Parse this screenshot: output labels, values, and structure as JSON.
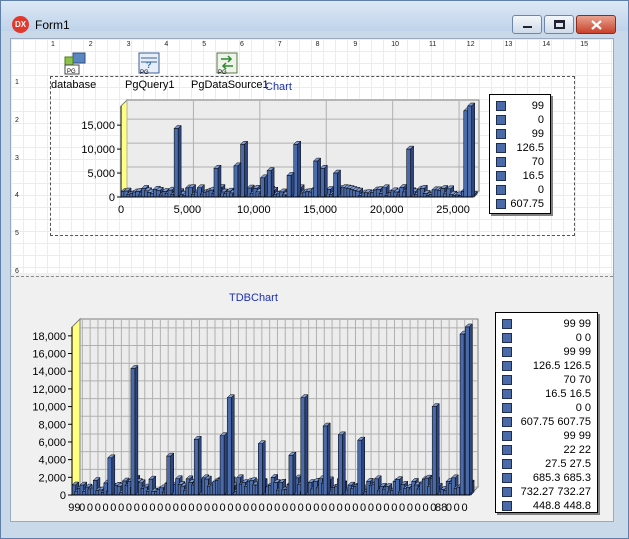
{
  "window": {
    "title": "Form1",
    "app_icon_text": "DX"
  },
  "ruler": {
    "h": [
      "1",
      "2",
      "3",
      "4",
      "5",
      "6",
      "7",
      "8",
      "9",
      "10",
      "11",
      "12",
      "13",
      "14",
      "15"
    ],
    "v": [
      "1",
      "2",
      "3",
      "4",
      "5",
      "6"
    ]
  },
  "components": [
    {
      "label": "database",
      "icon": "database-icon"
    },
    {
      "label": "PgQuery1",
      "icon": "query-icon"
    },
    {
      "label": "PgDataSource1",
      "icon": "datasource-icon"
    }
  ],
  "chart_data": [
    {
      "type": "bar",
      "title": "TDBChart",
      "title_visible": "Chart",
      "xlabel": "",
      "ylabel": "",
      "xlim": [
        0,
        26500
      ],
      "ylim": [
        0,
        19000
      ],
      "x_ticks": [
        "0",
        "5,000",
        "10,000",
        "15,000",
        "20,000",
        "25,000"
      ],
      "y_ticks": [
        "0",
        "5,000",
        "10,000",
        "15,000"
      ],
      "grid": true,
      "legend_position": "right",
      "legend": [
        "99",
        "0",
        "99",
        "126.5",
        "70",
        "16.5",
        "0",
        "607.75"
      ],
      "peaks": [
        {
          "x": 4000,
          "y": 14300
        },
        {
          "x": 9000,
          "y": 11000
        },
        {
          "x": 13000,
          "y": 11000
        },
        {
          "x": 21500,
          "y": 10000
        },
        {
          "x": 25800,
          "y": 18000
        },
        {
          "x": 26100,
          "y": 19000
        },
        {
          "x": 7000,
          "y": 6000
        },
        {
          "x": 8500,
          "y": 6500
        },
        {
          "x": 11000,
          "y": 5500
        },
        {
          "x": 15000,
          "y": 6000
        },
        {
          "x": 16000,
          "y": 5000
        },
        {
          "x": 14500,
          "y": 7500
        },
        {
          "x": 12500,
          "y": 4500
        },
        {
          "x": 10500,
          "y": 4000
        }
      ]
    },
    {
      "type": "bar",
      "title": "TDBChart",
      "xlabel": "",
      "ylabel": "",
      "ylim": [
        0,
        19000
      ],
      "x_ticks": [
        "99",
        "0",
        "0",
        "0",
        "0",
        "0",
        "0",
        "0",
        "0",
        "0",
        "0",
        "0",
        "0",
        "0",
        "0",
        "0",
        "0",
        "0",
        "0",
        "0",
        "0",
        "0",
        "0",
        "0",
        "0",
        "0",
        "0",
        "0",
        "0",
        "0",
        "0",
        "0",
        "0",
        "0",
        "0",
        "0",
        "0",
        "0",
        "0",
        "0",
        "0",
        "0",
        "0",
        "0",
        "0",
        "0",
        "0",
        "88",
        "0",
        "0",
        "0"
      ],
      "y_ticks": [
        "0",
        "2,000",
        "4,000",
        "6,000",
        "8,000",
        "10,000",
        "12,000",
        "14,000",
        "16,000",
        "18,000"
      ],
      "grid": true,
      "legend_position": "right",
      "legend": [
        "99 99",
        "0 0",
        "99 99",
        "126.5 126.5",
        "70 70",
        "16.5 16.5",
        "0 0",
        "607.75 607.75",
        "99 99",
        "22 22",
        "27.5 27.5",
        "685.3 685.3",
        "732.27 732.27",
        "448.8 448.8"
      ],
      "peaks": [
        {
          "x": 0.148,
          "y": 14300
        },
        {
          "x": 0.39,
          "y": 11000
        },
        {
          "x": 0.575,
          "y": 11000
        },
        {
          "x": 0.905,
          "y": 10000
        },
        {
          "x": 0.975,
          "y": 18200
        },
        {
          "x": 0.988,
          "y": 19000
        },
        {
          "x": 0.307,
          "y": 6300
        },
        {
          "x": 0.372,
          "y": 6700
        },
        {
          "x": 0.468,
          "y": 5800
        },
        {
          "x": 0.631,
          "y": 7800
        },
        {
          "x": 0.669,
          "y": 6800
        },
        {
          "x": 0.718,
          "y": 6200
        },
        {
          "x": 0.545,
          "y": 4500
        },
        {
          "x": 0.238,
          "y": 4400
        },
        {
          "x": 0.09,
          "y": 4200
        }
      ]
    }
  ]
}
